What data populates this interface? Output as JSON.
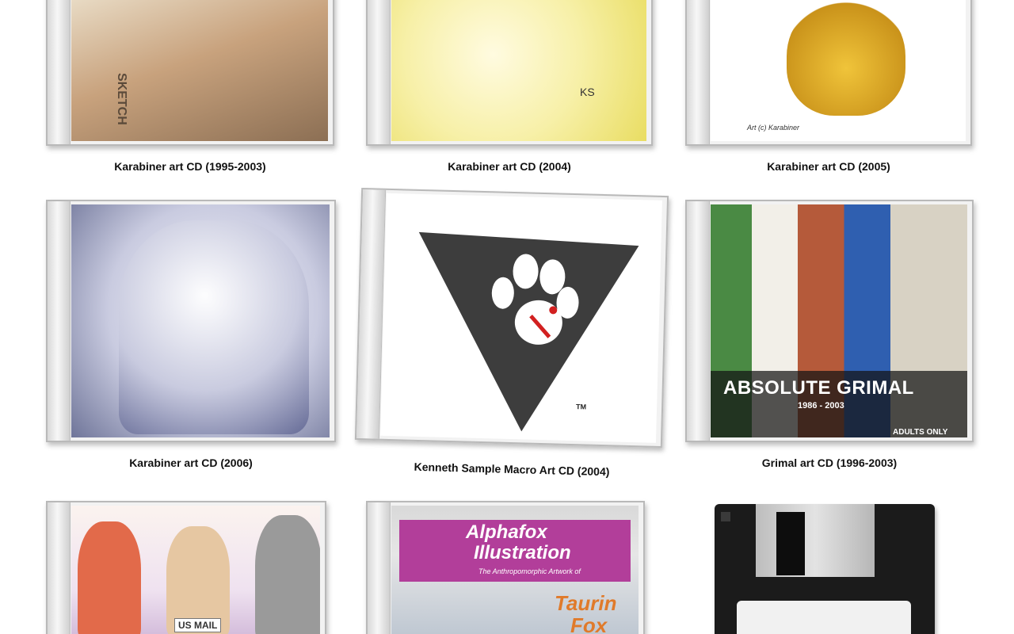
{
  "items": [
    {
      "caption": "Karabiner art CD (1995-2003)"
    },
    {
      "caption": "Karabiner art CD (2004)"
    },
    {
      "caption": "Karabiner art CD (2005)"
    },
    {
      "caption": "Karabiner art CD (2006)"
    },
    {
      "caption": "Kenneth Sample Macro Art CD (2004)",
      "tm": "TM"
    },
    {
      "caption": "Grimal art CD (1996-2003)",
      "cover_title": "ABSOLUTE GRIMAL",
      "cover_years": "1986 - 2003",
      "cover_note": "ADULTS ONLY"
    },
    {
      "cover_text": "US MAIL"
    },
    {
      "cover_title_1": "Alphafox",
      "cover_title_2": "Illustration",
      "cover_subtitle": "The Anthropomorphic Artwork of",
      "cover_name_1": "Taurin",
      "cover_name_2": "Fox"
    },
    {
      "type": "floppy"
    }
  ],
  "cover_art_signatures": {
    "item2": "KS",
    "item3": "Art (c) Karabiner",
    "item1_spine": "SKETCH"
  }
}
